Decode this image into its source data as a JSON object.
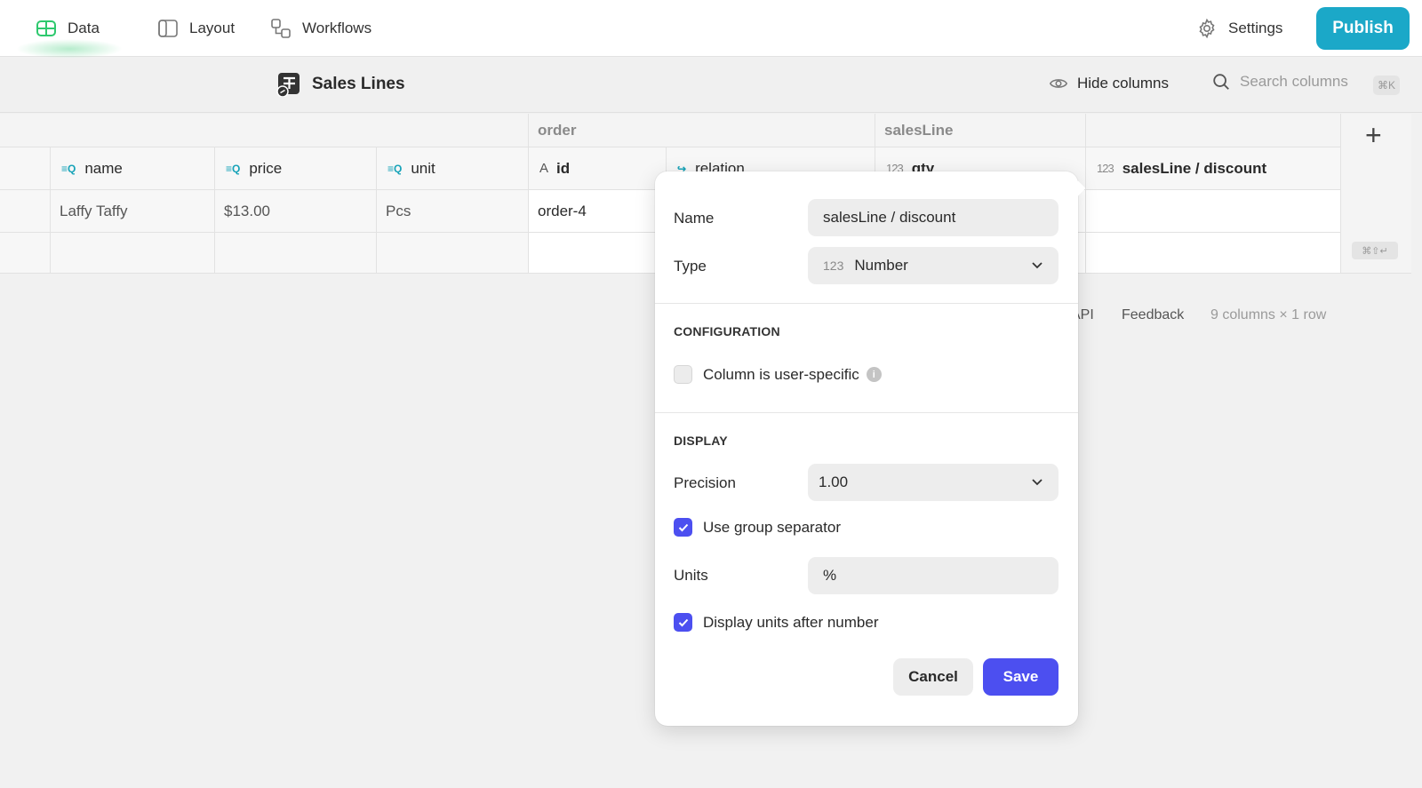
{
  "topbar": {
    "tabs": [
      {
        "label": "Data",
        "icon": "table-icon",
        "active": true
      },
      {
        "label": "Layout",
        "icon": "layout-icon"
      },
      {
        "label": "Workflows",
        "icon": "workflow-icon"
      }
    ],
    "settings_label": "Settings",
    "publish_label": "Publish"
  },
  "tablebar": {
    "title": "Sales Lines",
    "hide_columns_label": "Hide columns",
    "search_placeholder": "Search columns",
    "shortcut": "⌘K"
  },
  "grid": {
    "groups": [
      "order",
      "salesLine"
    ],
    "columns": [
      {
        "label": "name",
        "icon": "lookup-icon"
      },
      {
        "label": "price",
        "icon": "lookup-icon"
      },
      {
        "label": "unit",
        "icon": "lookup-icon"
      },
      {
        "label": "id",
        "icon": "text-icon",
        "icon_text": "A"
      },
      {
        "label": "relation",
        "icon": "relation-icon"
      },
      {
        "label": "qty",
        "icon": "number-icon",
        "icon_text": "123"
      },
      {
        "label": "salesLine / discount",
        "icon": "number-icon",
        "icon_text": "123"
      }
    ],
    "rows": [
      {
        "name": "Laffy Taffy",
        "price": "$13.00",
        "unit": "Pcs",
        "id": "order-4"
      }
    ],
    "add_row_shortcut": "⌘⇧↵"
  },
  "footer": {
    "api": "API",
    "feedback": "Feedback",
    "count": "9 columns × 1 row"
  },
  "popover": {
    "name_label": "Name",
    "name_value": "salesLine / discount",
    "type_label": "Type",
    "type_icon_text": "123",
    "type_value": "Number",
    "configuration_title": "CONFIGURATION",
    "user_specific_label": "Column is user-specific",
    "user_specific_checked": false,
    "info_glyph": "i",
    "display_title": "DISPLAY",
    "precision_label": "Precision",
    "precision_value": "1.00",
    "group_separator_label": "Use group separator",
    "group_separator_checked": true,
    "units_label": "Units",
    "units_value": "%",
    "units_after_label": "Display units after number",
    "units_after_checked": true,
    "cancel_label": "Cancel",
    "save_label": "Save"
  },
  "colors": {
    "publish": "#1ba8c8",
    "accent": "#4c4ff0",
    "data_tab": "#2ec96e",
    "lookup_icon": "#17a3b8"
  }
}
